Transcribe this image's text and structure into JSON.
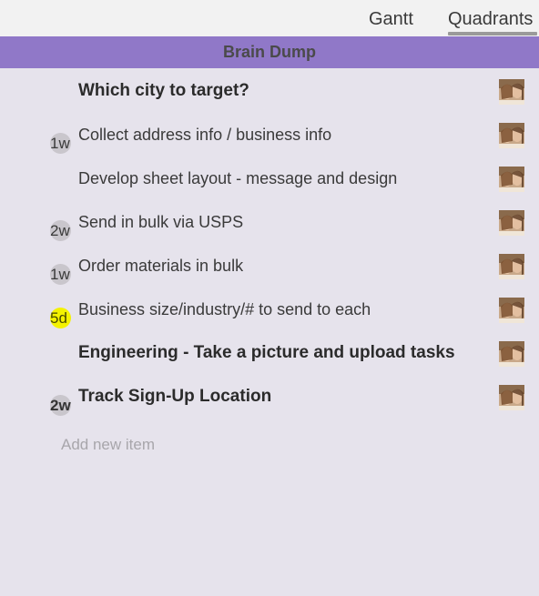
{
  "tabs": {
    "gantt": "Gantt",
    "quadrants": "Quadrants"
  },
  "section": {
    "title": "Brain Dump"
  },
  "items": [
    {
      "text": "Which city to target?",
      "bold": true,
      "badge": null
    },
    {
      "text": "Collect address info / business info",
      "bold": false,
      "badge": "1w"
    },
    {
      "text": "Develop sheet layout - message and design",
      "bold": false,
      "badge": null
    },
    {
      "text": "Send in bulk via USPS",
      "bold": false,
      "badge": "2w"
    },
    {
      "text": "Order materials in bulk",
      "bold": false,
      "badge": "1w"
    },
    {
      "text": "Business size/industry/# to send to each",
      "bold": false,
      "badge": "5d"
    },
    {
      "text": "Engineering - Take a picture and upload tasks",
      "bold": true,
      "badge": null
    },
    {
      "text": "Track Sign-Up Location",
      "bold": true,
      "badge": "2w"
    }
  ],
  "add_item": {
    "placeholder": "Add new item"
  },
  "colors": {
    "header_bg": "#9078c8",
    "page_bg": "#e6e3ec",
    "badge_gray": "#c9c6cc",
    "badge_yellow": "#f4f200"
  }
}
